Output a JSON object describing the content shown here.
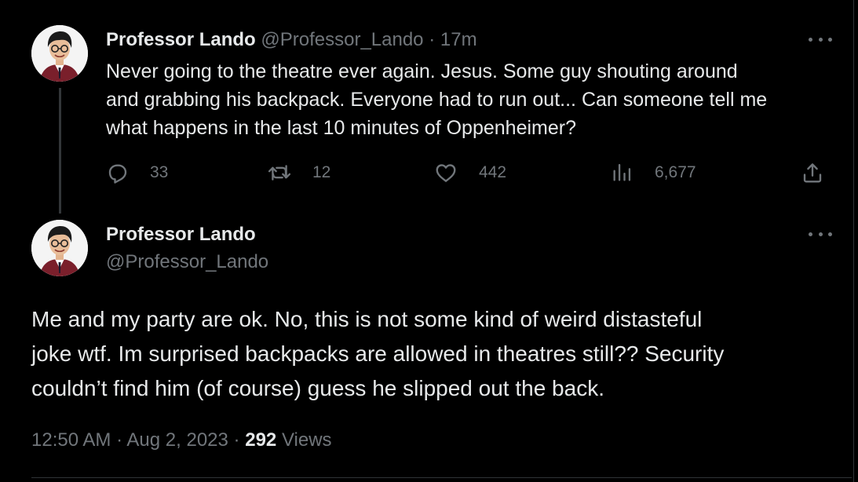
{
  "colors": {
    "background": "#000000",
    "text_primary": "#e7e9ea",
    "text_secondary": "#71767b",
    "divider": "#2f3336"
  },
  "tweet1": {
    "name": "Professor Lando",
    "handle": "@Professor_Lando",
    "separator": "·",
    "time": "17m",
    "text": "Never going to the theatre ever again. Jesus. Some guy shouting around\nand grabbing his backpack. Everyone had to run out... Can someone tell me\nwhat happens in the last 10 minutes of Oppenheimer?",
    "actions": {
      "replies": "33",
      "reposts": "12",
      "likes": "442",
      "views": "6,677"
    },
    "icons": {
      "reply": "reply-bubble-icon",
      "repost": "repost-arrows-icon",
      "like": "heart-icon",
      "views": "analytics-bars-icon",
      "share": "share-upload-icon",
      "more": "more-dots-icon"
    }
  },
  "tweet2": {
    "name": "Professor Lando",
    "handle": "@Professor_Lando",
    "text": "Me and my party are ok. No, this is not some kind of weird distasteful\njoke wtf. Im surprised backpacks are allowed in theatres still?? Security\ncouldn’t find him (of course) guess he slipped out the back.",
    "time": "12:50 AM",
    "separator1": "·",
    "date": "Aug 2, 2023",
    "separator2": "·",
    "views_count": "292",
    "views_label": "Views"
  }
}
